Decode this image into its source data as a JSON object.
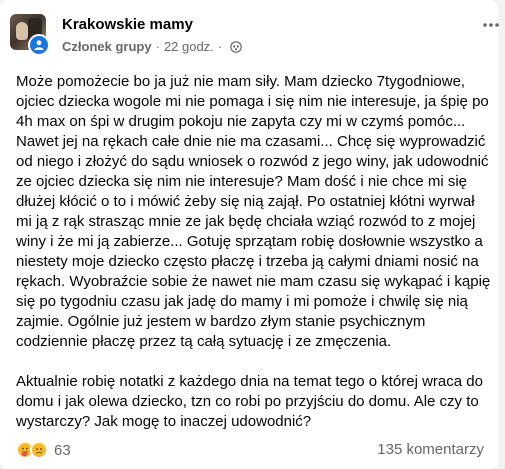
{
  "post": {
    "group_name": "Krakowskie mamy",
    "author_role": "Członek grupy",
    "separator": "·",
    "time_ago": "22 godz.",
    "paragraphs": [
      "Może pomożecie bo ja już nie mam siły. Mam dziecko 7tygodniowe, ojciec dziecka wogole mi nie pomaga i się nim nie interesuje, ja śpię po 4h max on śpi w drugim pokoju nie zapyta czy mi w czymś pomóc... Nawet jej na rękach całe dnie nie ma czasami... Chcę się wyprowadzić od niego i złożyć do sądu wniosek o rozwód z jego winy, jak udowodnić ze ojciec dziecka się nim nie interesuje? Mam dość i nie chce mi się dłużej kłócić o to i mówić żeby się nią zajął. Po ostatniej kłótni wyrwał mi ją z rąk strasząc mnie ze jak będę chciała wziąć rozwód to z mojej winy i że mi ją zabierze... Gotuję sprzątam robię dosłownie wszystko a niestety moje dziecko często płaczę i trzeba ją całymi dniami nosić na rękach. Wyobraźcie sobie że nawet nie mam czasu się wykąpać i kąpię się po tygodniu czasu jak jadę do mamy i mi pomoże i chwilę się nią zajmie. Ogólnie już jestem w bardzo złym stanie psychicznym codziennie płaczę przez tą całą sytuację i ze zmęczenia.",
      "Aktualnie robię notatki z każdego dnia na temat tego o której wraca do domu i jak olewa dziecko, tzn co robi po przyjściu do domu. Ale czy to wystarczy? Jak mogę to inaczej udowodnić?"
    ],
    "reactions": {
      "icons": [
        "care-emoji-icon",
        "sad-emoji-icon"
      ],
      "count": "63"
    },
    "comments_label": "135 komentarzy"
  },
  "colors": {
    "accent": "#1b74e4",
    "text": "#050505",
    "secondary_text": "#65676b",
    "card": "#ffffff",
    "background": "#f0f2f5"
  }
}
